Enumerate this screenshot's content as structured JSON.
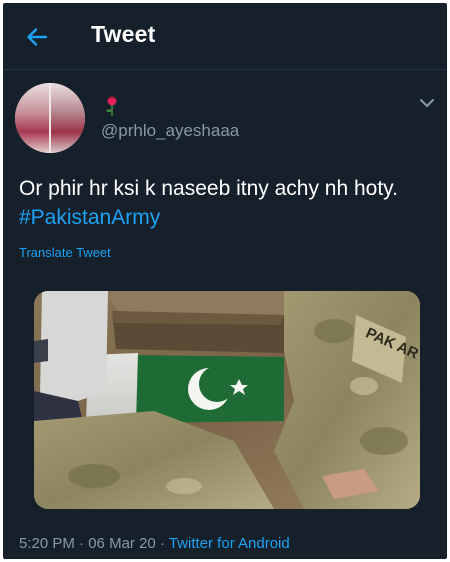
{
  "header": {
    "title": "Tweet",
    "back_icon": "arrow-left-icon"
  },
  "tweet": {
    "handle": "@prhlo_ayeshaaa",
    "name_icon": "rose-icon",
    "text": "Or phir hr ksi k naseeb itny achy nh hoty.",
    "hashtag": "#PakistanArmy",
    "translate_label": "Translate Tweet",
    "media_label": "PAK AR",
    "time": "5:20 PM",
    "date": "06 Mar 20",
    "source": "Twitter for Android",
    "separator": "·"
  },
  "colors": {
    "background": "#15202b",
    "accent": "#1da1f2",
    "secondary_text": "#8899a6",
    "divider": "#253341"
  }
}
